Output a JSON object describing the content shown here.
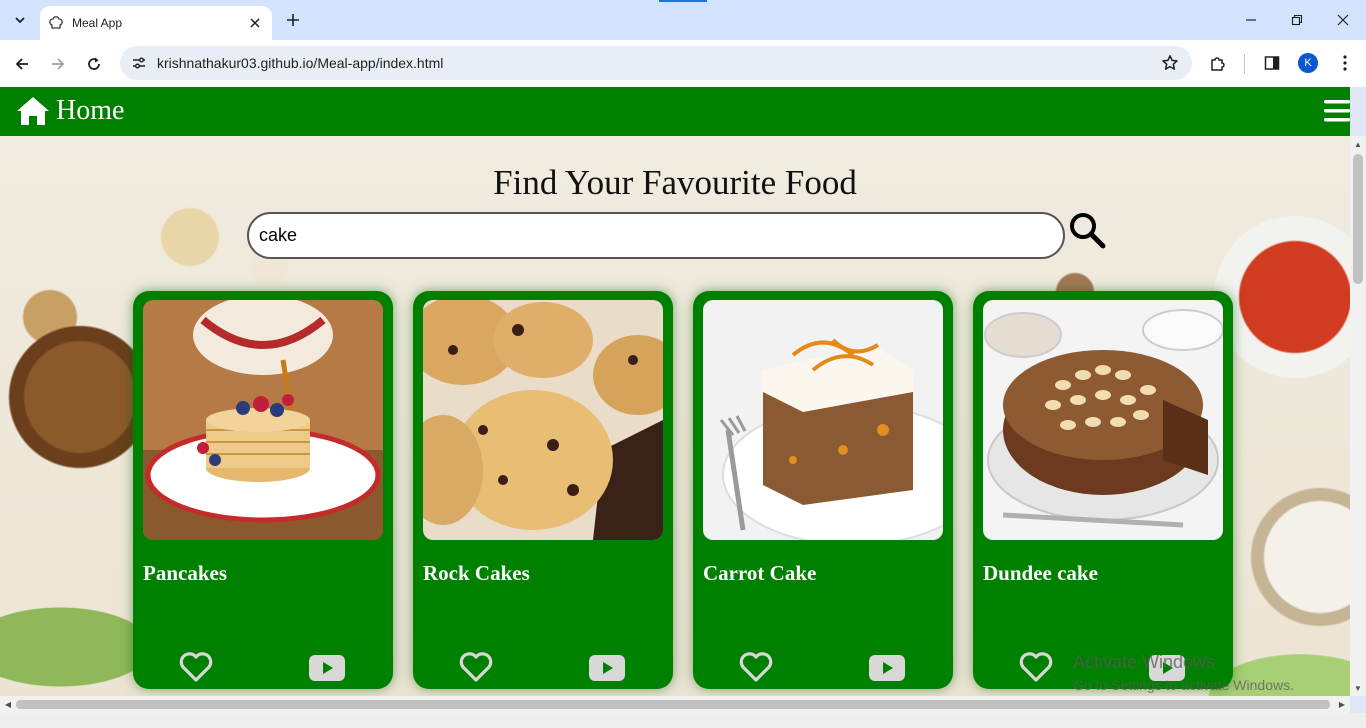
{
  "browser": {
    "tab_title": "Meal App",
    "url": "krishnathakur03.github.io/Meal-app/index.html",
    "avatar_letter": "K"
  },
  "navbar": {
    "home_label": "Home",
    "color": "#008000"
  },
  "main": {
    "heading": "Find Your Favourite Food",
    "search_value": "cake"
  },
  "meals": [
    {
      "name": "Pancakes",
      "icon": "pancakes-image"
    },
    {
      "name": "Rock Cakes",
      "icon": "rock-cakes-image"
    },
    {
      "name": "Carrot Cake",
      "icon": "carrot-cake-image"
    },
    {
      "name": "Dundee cake",
      "icon": "dundee-cake-image"
    }
  ],
  "watermark": {
    "line1": "Activate Windows",
    "line2": "Go to Settings to activate Windows."
  }
}
